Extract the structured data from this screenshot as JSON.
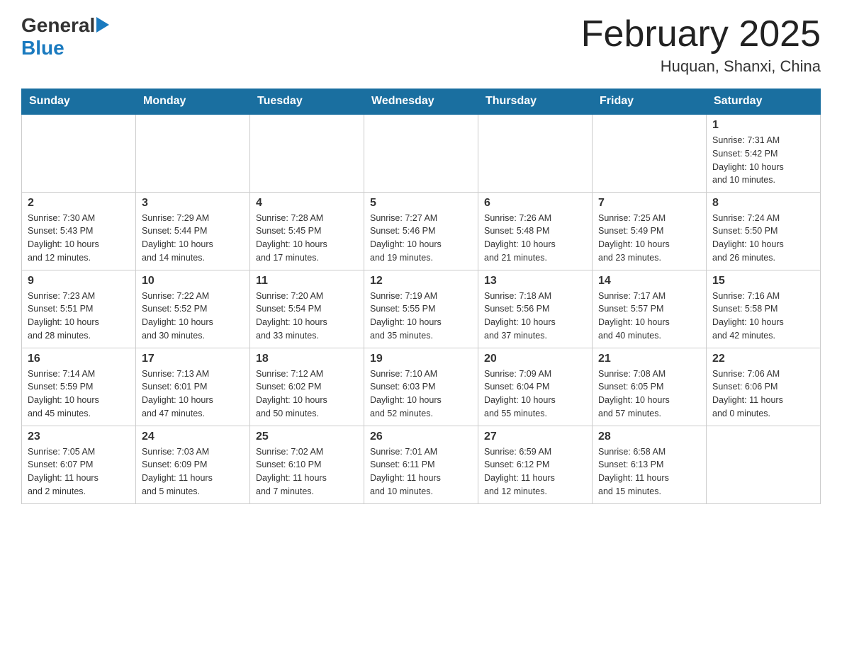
{
  "logo": {
    "general": "General",
    "blue": "Blue",
    "arrow": "▶"
  },
  "title": {
    "month_year": "February 2025",
    "location": "Huquan, Shanxi, China"
  },
  "header_days": [
    "Sunday",
    "Monday",
    "Tuesday",
    "Wednesday",
    "Thursday",
    "Friday",
    "Saturday"
  ],
  "weeks": [
    {
      "days": [
        {
          "num": "",
          "info": ""
        },
        {
          "num": "",
          "info": ""
        },
        {
          "num": "",
          "info": ""
        },
        {
          "num": "",
          "info": ""
        },
        {
          "num": "",
          "info": ""
        },
        {
          "num": "",
          "info": ""
        },
        {
          "num": "1",
          "info": "Sunrise: 7:31 AM\nSunset: 5:42 PM\nDaylight: 10 hours\nand 10 minutes."
        }
      ]
    },
    {
      "days": [
        {
          "num": "2",
          "info": "Sunrise: 7:30 AM\nSunset: 5:43 PM\nDaylight: 10 hours\nand 12 minutes."
        },
        {
          "num": "3",
          "info": "Sunrise: 7:29 AM\nSunset: 5:44 PM\nDaylight: 10 hours\nand 14 minutes."
        },
        {
          "num": "4",
          "info": "Sunrise: 7:28 AM\nSunset: 5:45 PM\nDaylight: 10 hours\nand 17 minutes."
        },
        {
          "num": "5",
          "info": "Sunrise: 7:27 AM\nSunset: 5:46 PM\nDaylight: 10 hours\nand 19 minutes."
        },
        {
          "num": "6",
          "info": "Sunrise: 7:26 AM\nSunset: 5:48 PM\nDaylight: 10 hours\nand 21 minutes."
        },
        {
          "num": "7",
          "info": "Sunrise: 7:25 AM\nSunset: 5:49 PM\nDaylight: 10 hours\nand 23 minutes."
        },
        {
          "num": "8",
          "info": "Sunrise: 7:24 AM\nSunset: 5:50 PM\nDaylight: 10 hours\nand 26 minutes."
        }
      ]
    },
    {
      "days": [
        {
          "num": "9",
          "info": "Sunrise: 7:23 AM\nSunset: 5:51 PM\nDaylight: 10 hours\nand 28 minutes."
        },
        {
          "num": "10",
          "info": "Sunrise: 7:22 AM\nSunset: 5:52 PM\nDaylight: 10 hours\nand 30 minutes."
        },
        {
          "num": "11",
          "info": "Sunrise: 7:20 AM\nSunset: 5:54 PM\nDaylight: 10 hours\nand 33 minutes."
        },
        {
          "num": "12",
          "info": "Sunrise: 7:19 AM\nSunset: 5:55 PM\nDaylight: 10 hours\nand 35 minutes."
        },
        {
          "num": "13",
          "info": "Sunrise: 7:18 AM\nSunset: 5:56 PM\nDaylight: 10 hours\nand 37 minutes."
        },
        {
          "num": "14",
          "info": "Sunrise: 7:17 AM\nSunset: 5:57 PM\nDaylight: 10 hours\nand 40 minutes."
        },
        {
          "num": "15",
          "info": "Sunrise: 7:16 AM\nSunset: 5:58 PM\nDaylight: 10 hours\nand 42 minutes."
        }
      ]
    },
    {
      "days": [
        {
          "num": "16",
          "info": "Sunrise: 7:14 AM\nSunset: 5:59 PM\nDaylight: 10 hours\nand 45 minutes."
        },
        {
          "num": "17",
          "info": "Sunrise: 7:13 AM\nSunset: 6:01 PM\nDaylight: 10 hours\nand 47 minutes."
        },
        {
          "num": "18",
          "info": "Sunrise: 7:12 AM\nSunset: 6:02 PM\nDaylight: 10 hours\nand 50 minutes."
        },
        {
          "num": "19",
          "info": "Sunrise: 7:10 AM\nSunset: 6:03 PM\nDaylight: 10 hours\nand 52 minutes."
        },
        {
          "num": "20",
          "info": "Sunrise: 7:09 AM\nSunset: 6:04 PM\nDaylight: 10 hours\nand 55 minutes."
        },
        {
          "num": "21",
          "info": "Sunrise: 7:08 AM\nSunset: 6:05 PM\nDaylight: 10 hours\nand 57 minutes."
        },
        {
          "num": "22",
          "info": "Sunrise: 7:06 AM\nSunset: 6:06 PM\nDaylight: 11 hours\nand 0 minutes."
        }
      ]
    },
    {
      "days": [
        {
          "num": "23",
          "info": "Sunrise: 7:05 AM\nSunset: 6:07 PM\nDaylight: 11 hours\nand 2 minutes."
        },
        {
          "num": "24",
          "info": "Sunrise: 7:03 AM\nSunset: 6:09 PM\nDaylight: 11 hours\nand 5 minutes."
        },
        {
          "num": "25",
          "info": "Sunrise: 7:02 AM\nSunset: 6:10 PM\nDaylight: 11 hours\nand 7 minutes."
        },
        {
          "num": "26",
          "info": "Sunrise: 7:01 AM\nSunset: 6:11 PM\nDaylight: 11 hours\nand 10 minutes."
        },
        {
          "num": "27",
          "info": "Sunrise: 6:59 AM\nSunset: 6:12 PM\nDaylight: 11 hours\nand 12 minutes."
        },
        {
          "num": "28",
          "info": "Sunrise: 6:58 AM\nSunset: 6:13 PM\nDaylight: 11 hours\nand 15 minutes."
        },
        {
          "num": "",
          "info": ""
        }
      ]
    }
  ]
}
